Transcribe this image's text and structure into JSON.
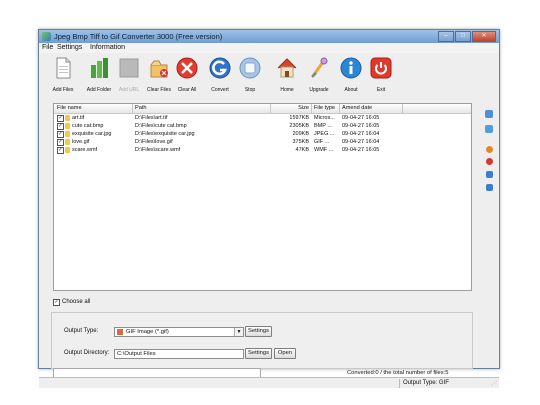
{
  "app": {
    "title": "Jpeg Bmp Tiff to Gif Converter 3000 (Free version)",
    "caption_buttons": [
      "minimize",
      "maximize",
      "close"
    ]
  },
  "menu": [
    "File",
    "Settings",
    "Information"
  ],
  "toolbar": [
    {
      "label": "Add Files",
      "icon": "add-files-icon",
      "enabled": true
    },
    {
      "label": "Add Folder",
      "icon": "add-folder-icon",
      "enabled": true
    },
    {
      "label": "Add URL",
      "icon": "add-url-icon",
      "enabled": false
    },
    {
      "label": "Clear Files",
      "icon": "clear-files-icon",
      "enabled": true
    },
    {
      "label": "Clear All",
      "icon": "clear-all-icon",
      "enabled": true
    },
    {
      "label": "Convert",
      "icon": "convert-icon",
      "enabled": true
    },
    {
      "label": "Stop",
      "icon": "stop-icon",
      "enabled": true
    },
    {
      "label": "Home",
      "icon": "home-icon",
      "enabled": true
    },
    {
      "label": "Upgrade",
      "icon": "upgrade-icon",
      "enabled": true
    },
    {
      "label": "About",
      "icon": "about-icon",
      "enabled": true
    },
    {
      "label": "Exit",
      "icon": "exit-icon",
      "enabled": true
    }
  ],
  "table": {
    "columns": [
      "File name",
      "Path",
      "Size",
      "File type",
      "Amend date"
    ],
    "rows": [
      {
        "name": "art.tif",
        "path": "D:\\Files\\art.tif",
        "size": "1597KB",
        "type": "Micros...",
        "date": "09-04-27 16:05",
        "checked": true
      },
      {
        "name": "cute cat.bmp",
        "path": "D:\\Files\\cute cat.bmp",
        "size": "2305KB",
        "type": "BMP ...",
        "date": "09-04-27 16:05",
        "checked": true
      },
      {
        "name": "exquisite car.jpg",
        "path": "D:\\Files\\exquisite car.jpg",
        "size": "209KB",
        "type": "JPEG ...",
        "date": "09-04-27 16:04",
        "checked": true
      },
      {
        "name": "love.gif",
        "path": "D:\\Files\\love.gif",
        "size": "375KB",
        "type": "GIF ...",
        "date": "09-04-27 16:04",
        "checked": true
      },
      {
        "name": "scare.wmf",
        "path": "D:\\Files\\scare.wmf",
        "size": "47KB",
        "type": "WMF ...",
        "date": "09-04-27 16:05",
        "checked": true
      }
    ]
  },
  "choose_all": {
    "label": "Choose all",
    "checked": true
  },
  "output": {
    "type_label": "Output Type:",
    "type_value": "GIF Image (*.gif)",
    "dir_label": "Output Directory:",
    "dir_value": "C:\\Output Files",
    "settings_label": "Settings",
    "open_label": "Open"
  },
  "status": {
    "converted_text": "Converted:0  /  the total number of files:5",
    "output_type_text": "Output Type: GIF",
    "progress_fraction": 0
  },
  "colors": {
    "accent": "#3e78c7",
    "progress": "#4caf50"
  }
}
